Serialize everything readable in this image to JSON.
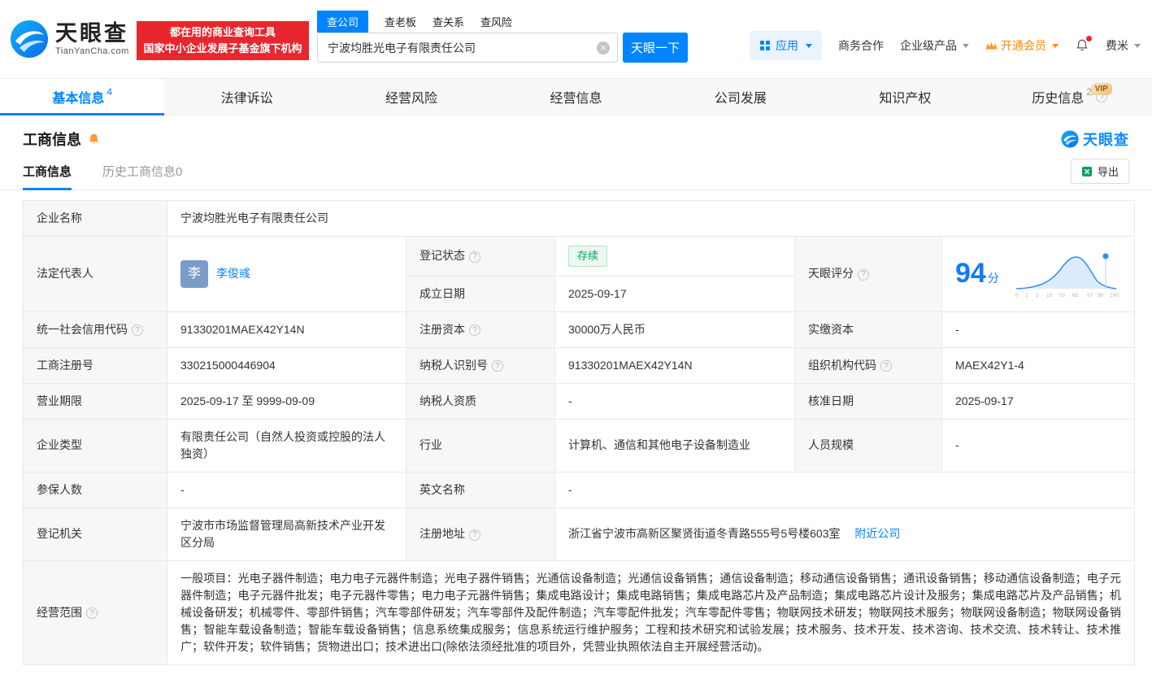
{
  "brand": {
    "name": "天眼查",
    "domain": "TianYanCha.com"
  },
  "header": {
    "promo_line1": "都在用的商业查询工具",
    "promo_line2": "国家中小企业发展子基金旗下机构",
    "search_tabs": [
      {
        "label": "查公司"
      },
      {
        "label": "查老板"
      },
      {
        "label": "查关系"
      },
      {
        "label": "查风险"
      }
    ],
    "search_value": "宁波均胜光电子有限责任公司",
    "search_button": "天眼一下",
    "nav_apps": "应用",
    "nav_cooperation": "商务合作",
    "nav_enterprise": "企业级产品",
    "nav_vip": "开通会员",
    "nav_user": "费米"
  },
  "nav_tabs": [
    {
      "label": "基本信息",
      "count": "4"
    },
    {
      "label": "法律诉讼"
    },
    {
      "label": "经营风险"
    },
    {
      "label": "经营信息"
    },
    {
      "label": "公司发展"
    },
    {
      "label": "知识产权"
    },
    {
      "label": "历史信息",
      "count": "2",
      "badge": "VIP"
    }
  ],
  "section": {
    "title": "工商信息",
    "watermark_brand": "天眼查",
    "subtab_active": "工商信息",
    "subtab_history": "历史工商信息0",
    "export": "导出"
  },
  "biz": {
    "company_name": {
      "label": "企业名称",
      "value": "宁波均胜光电子有限责任公司"
    },
    "legal_rep": {
      "label": "法定代表人",
      "avatar": "李",
      "name": "李俊彧"
    },
    "reg_status": {
      "label": "登记状态",
      "value": "存续"
    },
    "score": {
      "label": "天眼评分",
      "value": "94",
      "unit": "分",
      "axis": [
        "0",
        "1",
        "3",
        "15",
        "50",
        "65",
        "97",
        "99",
        "100"
      ]
    },
    "establish_date": {
      "label": "成立日期",
      "value": "2025-09-17"
    },
    "credit_code": {
      "label": "统一社会信用代码",
      "value": "91330201MAEX42Y14N"
    },
    "reg_capital": {
      "label": "注册资本",
      "value": "30000万人民币"
    },
    "paid_capital": {
      "label": "实缴资本",
      "value": "-"
    },
    "reg_number": {
      "label": "工商注册号",
      "value": "330215000446904"
    },
    "taxpayer_id": {
      "label": "纳税人识别号",
      "value": "91330201MAEX42Y14N"
    },
    "org_code": {
      "label": "组织机构代码",
      "value": "MAEX42Y1-4"
    },
    "business_term": {
      "label": "营业期限",
      "value": "2025-09-17 至 9999-09-09"
    },
    "taxpayer_quality": {
      "label": "纳税人资质",
      "value": "-"
    },
    "approval_date": {
      "label": "核准日期",
      "value": "2025-09-17"
    },
    "company_type": {
      "label": "企业类型",
      "value": "有限责任公司（自然人投资或控股的法人独资）"
    },
    "industry": {
      "label": "行业",
      "value": "计算机、通信和其他电子设备制造业"
    },
    "staff_size": {
      "label": "人员规模",
      "value": "-"
    },
    "insured_count": {
      "label": "参保人数",
      "value": "-"
    },
    "english_name": {
      "label": "英文名称",
      "value": "-"
    },
    "reg_authority": {
      "label": "登记机关",
      "value": "宁波市市场监督管理局高新技术产业开发区分局"
    },
    "reg_address": {
      "label": "注册地址",
      "value": "浙江省宁波市高新区聚贤街道冬青路555号5号楼603室",
      "link": "附近公司"
    },
    "business_scope": {
      "label": "经营范围",
      "value": "一般项目：光电子器件制造；电力电子元器件制造；光电子器件销售；光通信设备制造；光通信设备销售；通信设备制造；移动通信设备销售；通讯设备销售；移动通信设备制造；电子元器件制造；电子元器件批发；电子元器件零售；电力电子元器件销售；集成电路设计；集成电路销售；集成电路芯片及产品制造；集成电路芯片设计及服务；集成电路芯片及产品销售；机械设备研发；机械零件、零部件销售；汽车零部件研发；汽车零部件及配件制造；汽车零配件批发；汽车零配件零售；物联网技术研发；物联网技术服务；物联网设备制造；物联网设备销售；智能车载设备制造；智能车载设备销售；信息系统集成服务；信息系统运行维护服务；工程和技术研究和试验发展；技术服务、技术开发、技术咨询、技术交流、技术转让、技术推广；软件开发；软件销售；货物进出口；技术进出口(除依法须经批准的项目外，凭营业执照依法自主开展经营活动)。"
    }
  }
}
